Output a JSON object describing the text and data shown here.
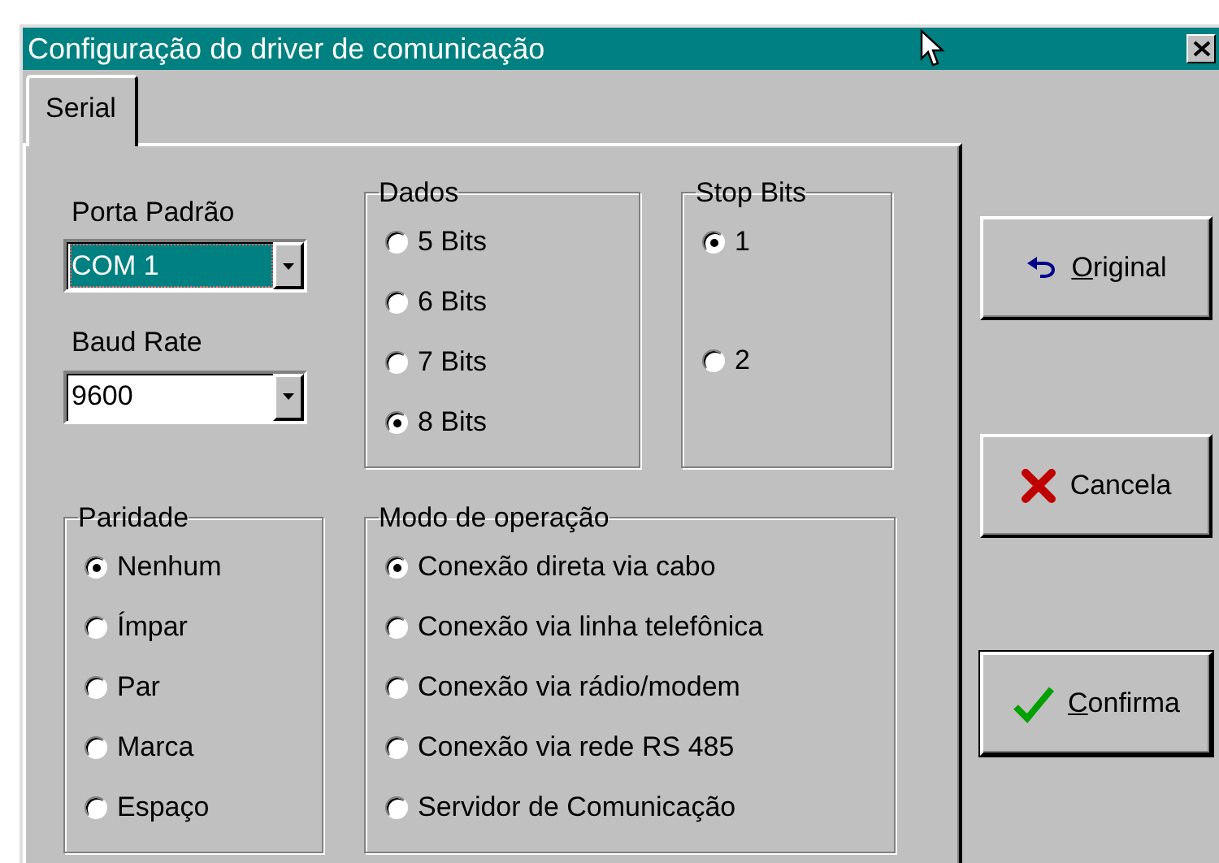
{
  "window": {
    "title": "Configuração do driver de comunicação"
  },
  "tabs": [
    {
      "label": "Serial",
      "selected": true
    }
  ],
  "porta_padrao": {
    "label": "Porta Padrão",
    "value": "COM 1",
    "highlighted": true
  },
  "baud_rate": {
    "label": "Baud Rate",
    "value": "9600"
  },
  "dados": {
    "title": "Dados",
    "options": [
      {
        "label": "5 Bits",
        "selected": false
      },
      {
        "label": "6 Bits",
        "selected": false
      },
      {
        "label": "7 Bits",
        "selected": false
      },
      {
        "label": "8 Bits",
        "selected": true
      }
    ]
  },
  "stop_bits": {
    "title": "Stop Bits",
    "options": [
      {
        "label": "1",
        "selected": true
      },
      {
        "label": "2",
        "selected": false
      }
    ]
  },
  "paridade": {
    "title": "Paridade",
    "options": [
      {
        "label": "Nenhum",
        "selected": true
      },
      {
        "label": "Ímpar",
        "selected": false
      },
      {
        "label": "Par",
        "selected": false
      },
      {
        "label": "Marca",
        "selected": false
      },
      {
        "label": "Espaço",
        "selected": false
      }
    ]
  },
  "modo_de_operacao": {
    "title": "Modo de operação",
    "options": [
      {
        "label": "Conexão direta via cabo",
        "selected": true
      },
      {
        "label": "Conexão via linha telefônica",
        "selected": false
      },
      {
        "label": "Conexão via rádio/modem",
        "selected": false
      },
      {
        "label": "Conexão via rede RS 485",
        "selected": false
      },
      {
        "label": "Servidor de Comunicação",
        "selected": false
      }
    ]
  },
  "buttons": [
    {
      "label": "Original",
      "kind": "undo",
      "underline_first": true,
      "default": false
    },
    {
      "label": "Cancela",
      "kind": "cancel",
      "default": false
    },
    {
      "label": "Confirma",
      "kind": "confirm",
      "underline_first": true,
      "default": true
    }
  ]
}
